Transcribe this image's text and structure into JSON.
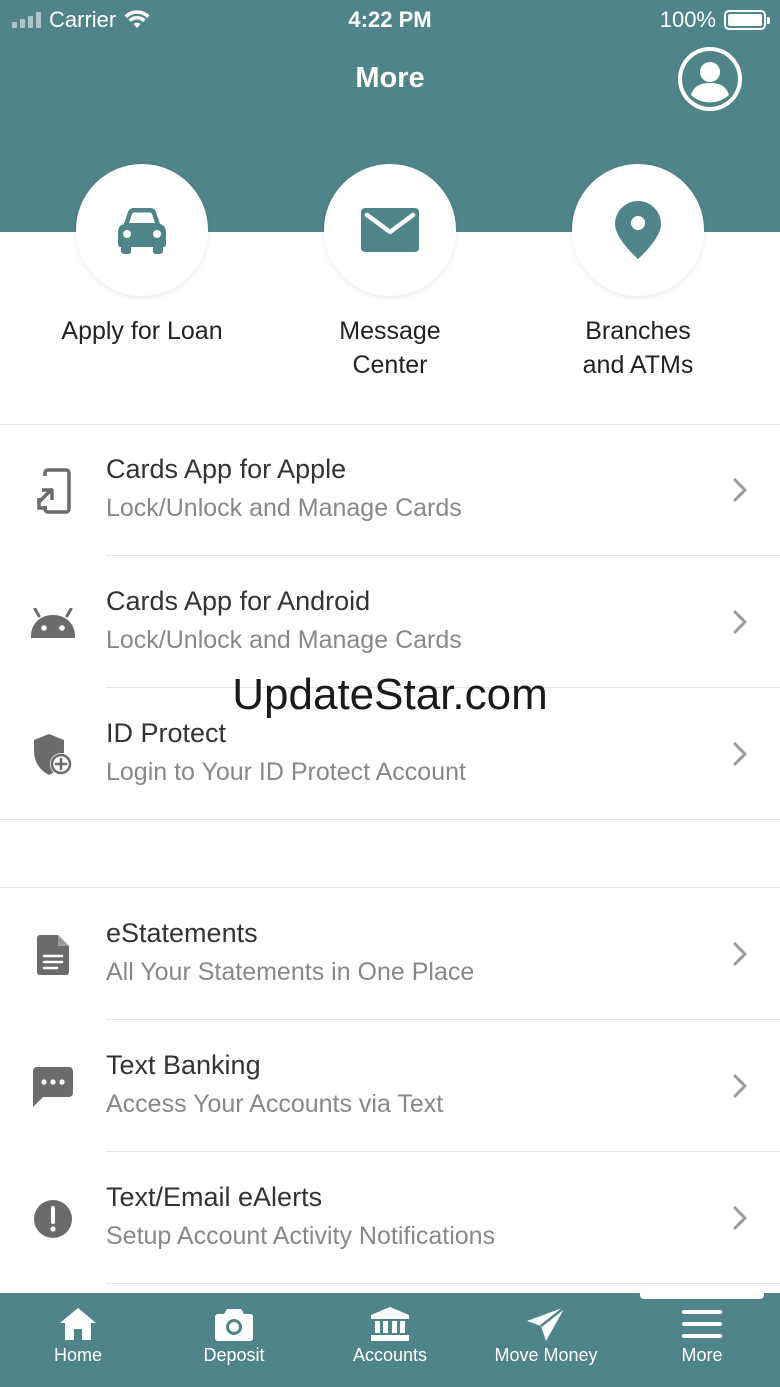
{
  "status_bar": {
    "carrier": "Carrier",
    "time": "4:22 PM",
    "battery": "100%"
  },
  "header": {
    "title": "More"
  },
  "quick_actions": [
    {
      "label": "Apply for Loan",
      "icon": "car-icon"
    },
    {
      "label": "Message\nCenter",
      "icon": "envelope-icon"
    },
    {
      "label": "Branches\nand ATMs",
      "icon": "map-pin-icon"
    }
  ],
  "list": [
    {
      "title": "Cards App for Apple",
      "subtitle": "Lock/Unlock and Manage Cards",
      "icon": "phone-app-icon"
    },
    {
      "title": "Cards App for Android",
      "subtitle": "Lock/Unlock and Manage Cards",
      "icon": "android-icon"
    },
    {
      "title": "ID Protect",
      "subtitle": "Login to Your ID Protect Account",
      "icon": "shield-plus-icon"
    },
    {
      "title": "eStatements",
      "subtitle": "All Your Statements in One Place",
      "icon": "document-icon"
    },
    {
      "title": "Text Banking",
      "subtitle": "Access Your Accounts via Text",
      "icon": "chat-bubble-icon"
    },
    {
      "title": "Text/Email eAlerts",
      "subtitle": "Setup Account Activity Notifications",
      "icon": "alert-circle-icon"
    }
  ],
  "watermark": "UpdateStar.com",
  "tabbar": [
    {
      "label": "Home",
      "icon": "home-icon"
    },
    {
      "label": "Deposit",
      "icon": "camera-icon"
    },
    {
      "label": "Accounts",
      "icon": "bank-icon"
    },
    {
      "label": "Move Money",
      "icon": "paper-plane-icon"
    },
    {
      "label": "More",
      "icon": "menu-icon"
    }
  ],
  "colors": {
    "brand": "#4f8489",
    "icon_gray": "#6b6b6b",
    "text_primary": "#333333",
    "text_secondary": "#888888"
  }
}
